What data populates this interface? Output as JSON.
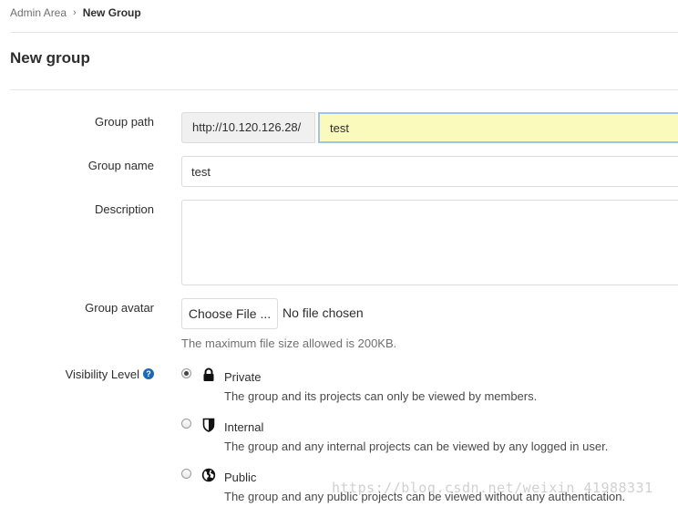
{
  "breadcrumb": {
    "items": [
      {
        "label": "Admin Area"
      },
      {
        "label": "New Group"
      }
    ],
    "separator": "›"
  },
  "page": {
    "title": "New group"
  },
  "form": {
    "group_path": {
      "label": "Group path",
      "prefix": "http://10.120.126.28/",
      "value": "test"
    },
    "group_name": {
      "label": "Group name",
      "value": "test"
    },
    "description": {
      "label": "Description",
      "value": ""
    },
    "avatar": {
      "label": "Group avatar",
      "button_label": "Choose File ...",
      "status": "No file chosen",
      "help": "The maximum file size allowed is 200KB."
    },
    "visibility": {
      "label": "Visibility Level",
      "help_icon": "question-circle-icon",
      "selected": "private",
      "options": [
        {
          "key": "private",
          "icon": "lock-icon",
          "title": "Private",
          "description": "The group and its projects can only be viewed by members."
        },
        {
          "key": "internal",
          "icon": "shield-icon",
          "title": "Internal",
          "description": "The group and any internal projects can be viewed by any logged in user."
        },
        {
          "key": "public",
          "icon": "globe-icon",
          "title": "Public",
          "description": "The group and any public projects can be viewed without any authentication."
        }
      ]
    }
  },
  "watermark": "https://blog.csdn.net/weixin_41988331",
  "colors": {
    "path_input_bg": "#fafabc",
    "focus_border": "#9fc5ef",
    "help_icon": "#1b69b6",
    "muted_text": "#707070"
  }
}
